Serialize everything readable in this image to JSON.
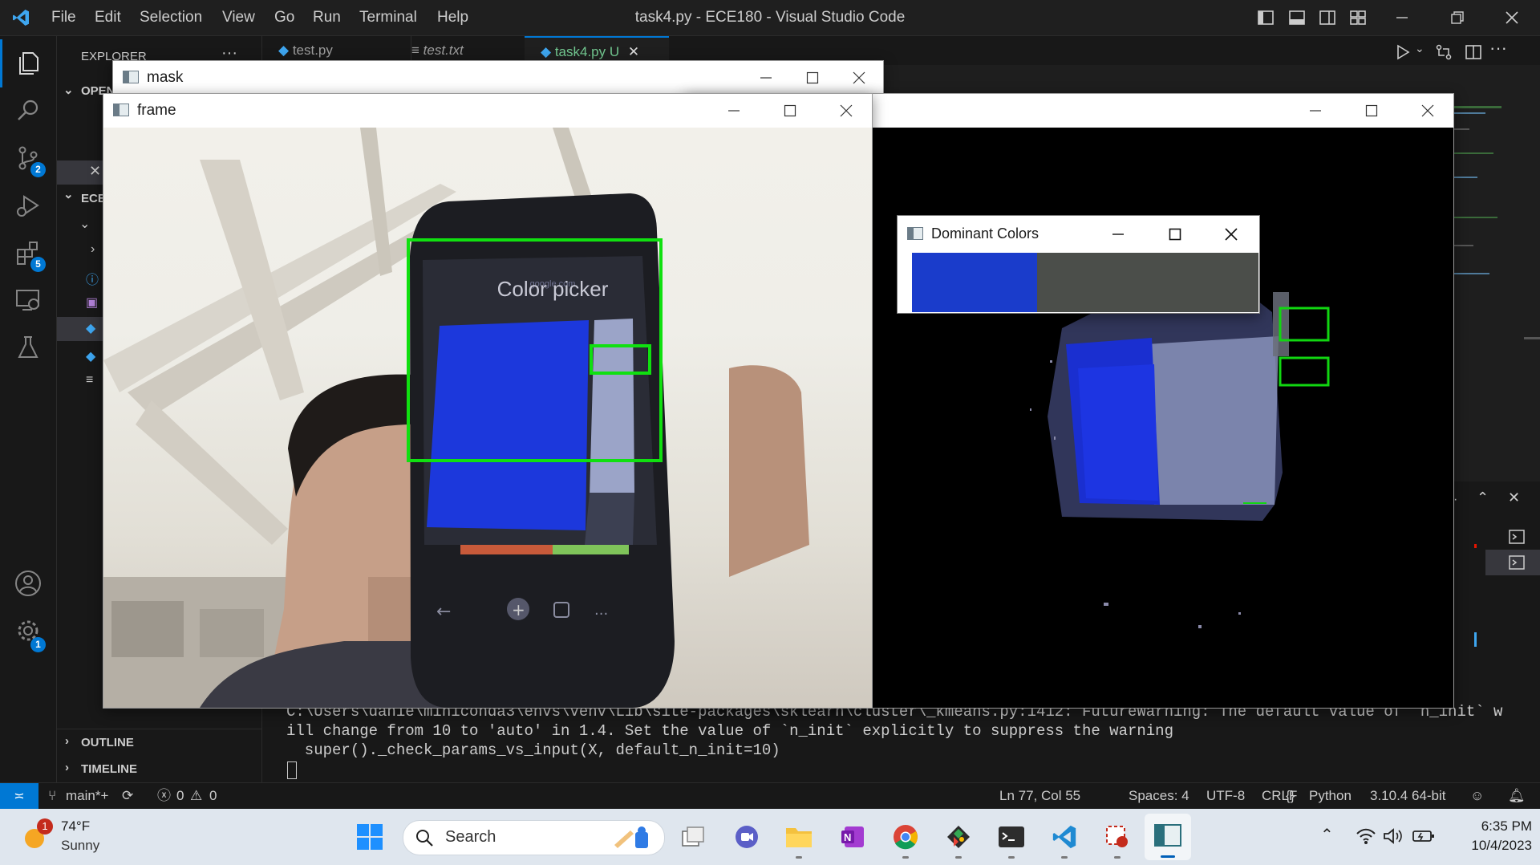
{
  "titlebar": {
    "menu": [
      "File",
      "Edit",
      "Selection",
      "View",
      "Go",
      "Run",
      "Terminal",
      "Help"
    ],
    "title": "task4.py - ECE180 - Visual Studio Code"
  },
  "activity": {
    "badges": {
      "source_control": "2",
      "extensions": "5",
      "settings": "1"
    }
  },
  "sidebar": {
    "header": "EXPLORER",
    "open_editors": "OPEN",
    "project": "ECE",
    "outline": "OUTLINE",
    "timeline": "TIMELINE"
  },
  "tabs": [
    {
      "label": "test.py"
    },
    {
      "label": "test.txt"
    },
    {
      "label": "task4.py U"
    }
  ],
  "terminal": {
    "lines": [
      "C:\\Users\\danie\\miniconda3\\envs\\venv\\Lib\\site-packages\\sklearn\\cluster\\_kmeans.py:1412: FutureWarning: The default value of `n_init` w",
      "ill change from 10 to 'auto' in 1.4. Set the value of `n_init` explicitly to suppress the warning",
      "  super()._check_params_vs_input(X, default_n_init=10)"
    ]
  },
  "statusbar": {
    "branch": "main*+",
    "errors": "0",
    "warnings": "0",
    "position": "Ln 77, Col 55",
    "spaces": "Spaces: 4",
    "encoding": "UTF-8",
    "eol": "CRLF",
    "language": "Python",
    "interpreter": "3.10.4 64-bit"
  },
  "windows": {
    "mask": {
      "title": "mask"
    },
    "frame": {
      "title": "frame"
    },
    "dominant": {
      "title": "Dominant Colors",
      "colors": [
        "#1a3ccb",
        "#4b4e4a"
      ],
      "proportions": [
        0.36,
        0.64
      ]
    }
  },
  "phone_screen": {
    "url": "google.com",
    "heading": "Color picker"
  },
  "taskbar": {
    "weather_temp": "74°F",
    "weather_desc": "Sunny",
    "weather_badge": "1",
    "search_placeholder": "Search",
    "time": "6:35 PM",
    "date": "10/4/2023"
  }
}
